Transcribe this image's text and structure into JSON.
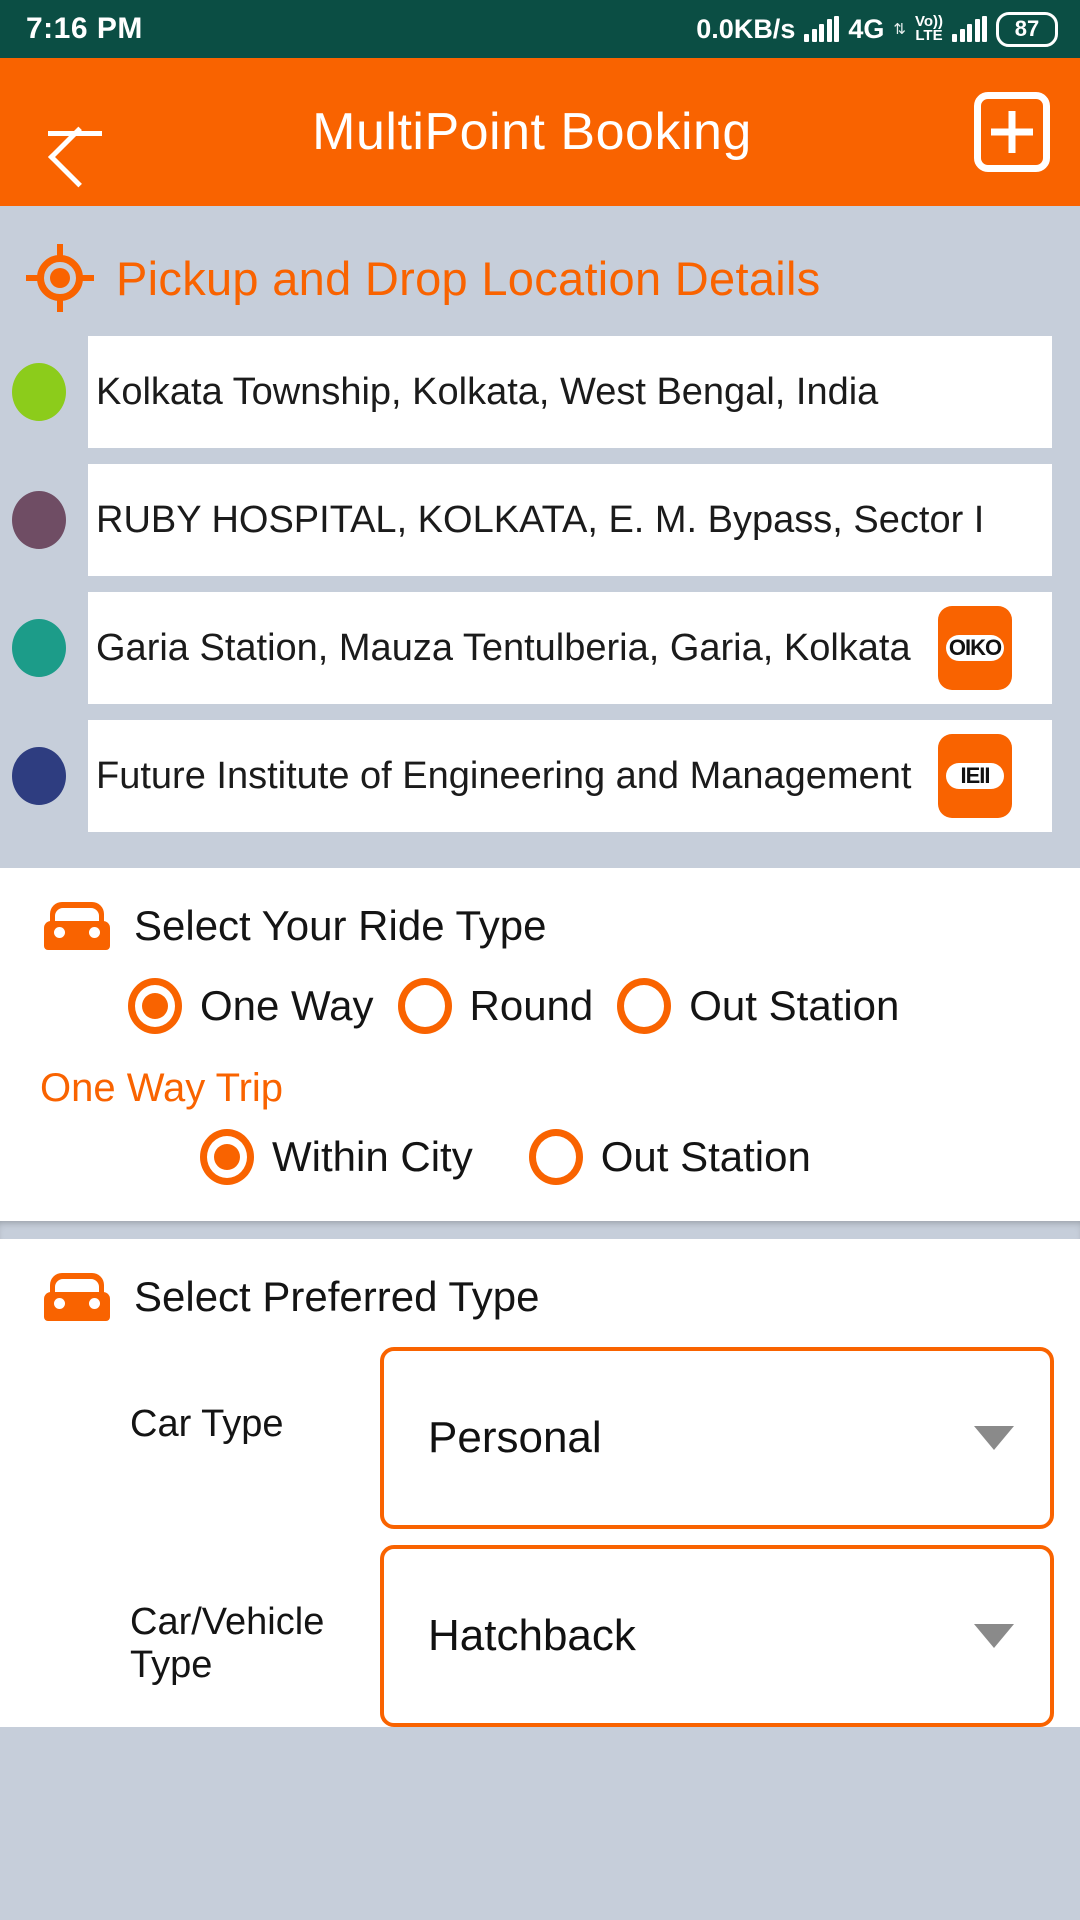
{
  "status_bar": {
    "time": "7:16 PM",
    "net_speed": "0.0KB/s",
    "network_type": "4G",
    "volte_top": "Vo))",
    "volte_bottom": "LTE",
    "battery": "87",
    "bg_color": "#0B4E44"
  },
  "app_bar": {
    "title": "MultiPoint Booking",
    "back_icon": "back-arrow-icon",
    "add_icon": "add-box-icon",
    "bg_color": "#F96300"
  },
  "locations": {
    "section_title": "Pickup and Drop Location Details",
    "section_icon": "gps-crosshair-icon",
    "rows": [
      {
        "text": "Kolkata Township, Kolkata, West Bengal, India",
        "dot_color": "#8CCC1B",
        "has_button": false,
        "button_glyph": ""
      },
      {
        "text": "RUBY HOSPITAL, KOLKATA, E. M. Bypass, Sector I",
        "dot_color": "#6F4D64",
        "has_button": false,
        "button_glyph": ""
      },
      {
        "text": "Garia Station, Mauza Tentulberia, Garia, Kolkata",
        "dot_color": "#1C9C89",
        "has_button": true,
        "button_glyph": "OIKO"
      },
      {
        "text": "Future Institute of Engineering and Management",
        "dot_color": "#2E3D80",
        "has_button": true,
        "button_glyph": "IEII"
      }
    ]
  },
  "ride_type": {
    "title": "Select Your Ride Type",
    "icon": "car-icon",
    "options": [
      {
        "label": "One Way",
        "selected": true
      },
      {
        "label": "Round",
        "selected": false
      },
      {
        "label": "Out Station",
        "selected": false
      }
    ],
    "sub_title": "One Way Trip",
    "sub_options": [
      {
        "label": "Within City",
        "selected": true
      },
      {
        "label": "Out Station",
        "selected": false
      }
    ]
  },
  "preferred_type": {
    "title": "Select Preferred Type",
    "icon": "car-icon",
    "fields": [
      {
        "label": "Car Type",
        "value": "Personal",
        "caret": "chevron-down-icon"
      },
      {
        "label": "Car/Vehicle Type",
        "value": "Hatchback",
        "caret": "chevron-down-icon"
      }
    ]
  },
  "theme": {
    "accent": "#F96300",
    "page_bg": "#C6CEDA",
    "card_bg": "#FFFFFF"
  }
}
